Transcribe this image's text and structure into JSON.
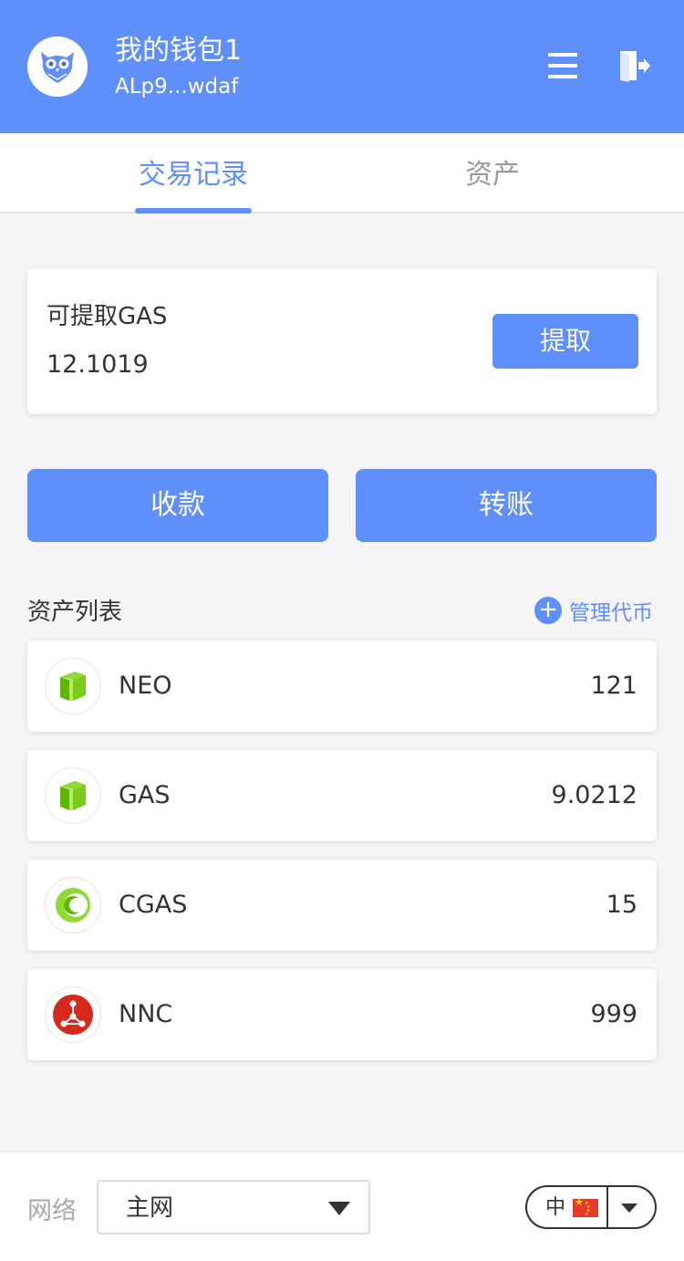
{
  "header": {
    "wallet_name": "我的钱包1",
    "wallet_address": "ALp9...wdaf",
    "icons": {
      "avatar": "owl-logo",
      "menu": "menu-icon",
      "exit": "exit-icon"
    },
    "color": "#5f8ffb"
  },
  "tabs": [
    {
      "label": "交易记录",
      "active": true
    },
    {
      "label": "资产",
      "active": false
    }
  ],
  "claim": {
    "label": "可提取GAS",
    "value": "12.1019",
    "button": "提取"
  },
  "actions": {
    "receive": "收款",
    "transfer": "转账"
  },
  "asset_list": {
    "title": "资产列表",
    "manage": "管理代币",
    "items": [
      {
        "name": "NEO",
        "amount": "121",
        "icon": "neo-icon"
      },
      {
        "name": "GAS",
        "amount": "9.0212",
        "icon": "gas-icon"
      },
      {
        "name": "CGAS",
        "amount": "15",
        "icon": "cgas-icon"
      },
      {
        "name": "NNC",
        "amount": "999",
        "icon": "nnc-icon"
      }
    ]
  },
  "footer": {
    "network_label": "网络",
    "network_value": "主网",
    "language": "中",
    "flag": "china-flag-icon"
  }
}
